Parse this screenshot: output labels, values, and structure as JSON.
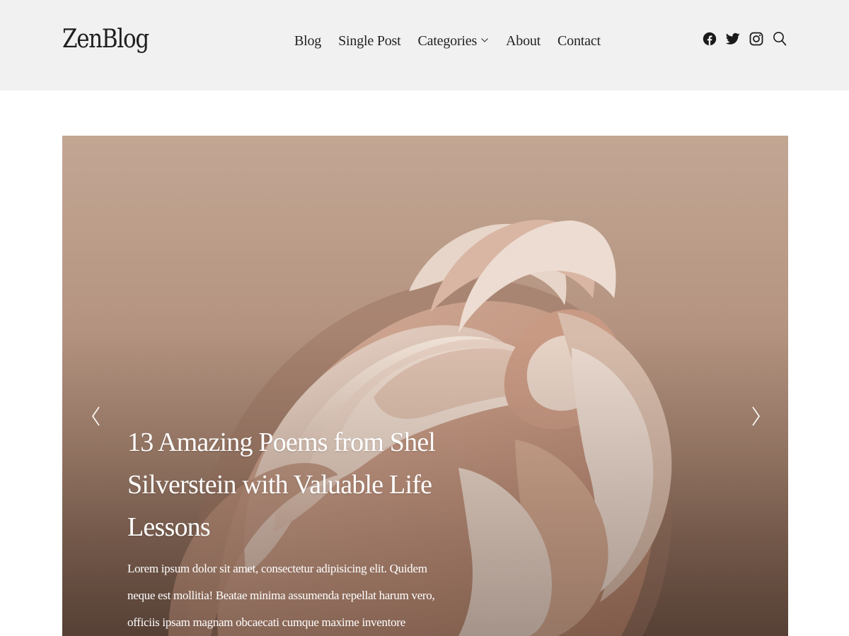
{
  "header": {
    "logo": "ZenBlog",
    "nav": [
      {
        "label": "Blog"
      },
      {
        "label": "Single Post"
      },
      {
        "label": "Categories",
        "dropdown": true
      },
      {
        "label": "About"
      },
      {
        "label": "Contact"
      }
    ],
    "social_icons": [
      "facebook-icon",
      "twitter-icon",
      "instagram-icon",
      "search-icon"
    ]
  },
  "hero": {
    "title": "13 Amazing Poems from Shel Silverstein with Valuable Life Lessons",
    "excerpt": "Lorem ipsum dolor sit amet, consectetur adipisicing elit. Quidem neque est mollitia! Beatae minima assumenda repellat harum vero, officiis ipsam magnam obcaecati cumque maxime inventore repudiandae quidem necessitatibus rem atque.",
    "prev_icon": "chevron-left-icon",
    "next_icon": "chevron-right-icon"
  },
  "colors": {
    "header_bg": "#f1f1f1",
    "text": "#222222",
    "hero_text": "#ffffff"
  }
}
